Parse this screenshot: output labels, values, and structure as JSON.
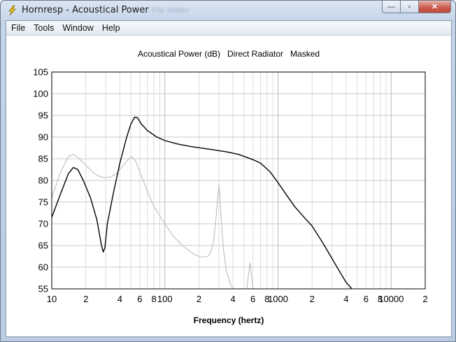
{
  "window": {
    "title": "Hornresp - Acoustical Power",
    "ghost_text": "File folder",
    "controls": {
      "minimize": "—",
      "maximize": "▫",
      "close": "✕"
    }
  },
  "menu": [
    "File",
    "Tools",
    "Window",
    "Help"
  ],
  "colors": {
    "primary_series": "#000000",
    "masked_series": "#bdbdbd",
    "grid": "#c8c8c8"
  },
  "chart_data": {
    "type": "line",
    "title": "Acoustical Power (dB)   Direct Radiator   Masked",
    "xlabel": "Frequency (hertz)",
    "ylabel": "",
    "xscale": "log",
    "xlim": [
      10,
      20000
    ],
    "ylim": [
      55,
      105
    ],
    "yticks": [
      "105",
      "100",
      "95",
      "90",
      "85",
      "80",
      "75",
      "70",
      "65",
      "60",
      "55"
    ],
    "xticks": [
      {
        "f": 10,
        "label": "10"
      },
      {
        "f": 20,
        "label": "2"
      },
      {
        "f": 40,
        "label": "4"
      },
      {
        "f": 60,
        "label": "6"
      },
      {
        "f": 80,
        "label": "8"
      },
      {
        "f": 100,
        "label": "100"
      },
      {
        "f": 200,
        "label": "2"
      },
      {
        "f": 400,
        "label": "4"
      },
      {
        "f": 600,
        "label": "6"
      },
      {
        "f": 800,
        "label": "8"
      },
      {
        "f": 1000,
        "label": "1000"
      },
      {
        "f": 2000,
        "label": "2"
      },
      {
        "f": 4000,
        "label": "4"
      },
      {
        "f": 6000,
        "label": "6"
      },
      {
        "f": 8000,
        "label": "8"
      },
      {
        "f": 10000,
        "label": "10000"
      },
      {
        "f": 20000,
        "label": "2"
      }
    ],
    "grid": true,
    "series": [
      {
        "color": "#000000",
        "points": [
          [
            10,
            71.5
          ],
          [
            12,
            77
          ],
          [
            14,
            81.5
          ],
          [
            15.5,
            83
          ],
          [
            17,
            82.5
          ],
          [
            19,
            80
          ],
          [
            22,
            76
          ],
          [
            25,
            71
          ],
          [
            27.5,
            65
          ],
          [
            28.5,
            63.5
          ],
          [
            29.5,
            64.5
          ],
          [
            31,
            70
          ],
          [
            35,
            77
          ],
          [
            40,
            84
          ],
          [
            46,
            90
          ],
          [
            50,
            93
          ],
          [
            54,
            94.6
          ],
          [
            57,
            94.5
          ],
          [
            62,
            93
          ],
          [
            70,
            91.5
          ],
          [
            85,
            90
          ],
          [
            100,
            89.2
          ],
          [
            130,
            88.4
          ],
          [
            170,
            87.8
          ],
          [
            250,
            87.2
          ],
          [
            350,
            86.6
          ],
          [
            450,
            86
          ],
          [
            600,
            84.8
          ],
          [
            700,
            84
          ],
          [
            850,
            82
          ],
          [
            1000,
            79.5
          ],
          [
            1200,
            76.5
          ],
          [
            1400,
            74
          ],
          [
            1700,
            71.5
          ],
          [
            2000,
            69.5
          ],
          [
            2500,
            65.5
          ],
          [
            3000,
            62
          ],
          [
            3500,
            59
          ],
          [
            4000,
            56.5
          ],
          [
            4500,
            55
          ]
        ]
      },
      {
        "color": "#bdbdbd",
        "points": [
          [
            10,
            76
          ],
          [
            12,
            82
          ],
          [
            14,
            85.5
          ],
          [
            15.5,
            86
          ],
          [
            17,
            85.3
          ],
          [
            20,
            83.5
          ],
          [
            24,
            81.5
          ],
          [
            28,
            80.7
          ],
          [
            32,
            80.7
          ],
          [
            37,
            81.5
          ],
          [
            43,
            83.5
          ],
          [
            48,
            85
          ],
          [
            51,
            85.5
          ],
          [
            55,
            84.5
          ],
          [
            60,
            82
          ],
          [
            70,
            77.5
          ],
          [
            80,
            74
          ],
          [
            100,
            70
          ],
          [
            120,
            67
          ],
          [
            150,
            64.5
          ],
          [
            180,
            63
          ],
          [
            210,
            62.3
          ],
          [
            240,
            62.5
          ],
          [
            255,
            63.5
          ],
          [
            270,
            66
          ],
          [
            285,
            72
          ],
          [
            295,
            77
          ],
          [
            300,
            79
          ],
          [
            305,
            77
          ],
          [
            315,
            71
          ],
          [
            330,
            64
          ],
          [
            350,
            59
          ],
          [
            380,
            56
          ],
          [
            400,
            55
          ],
          [
            530,
            55
          ],
          [
            550,
            58.5
          ],
          [
            565,
            61
          ],
          [
            580,
            58.5
          ],
          [
            600,
            55
          ]
        ]
      }
    ]
  }
}
